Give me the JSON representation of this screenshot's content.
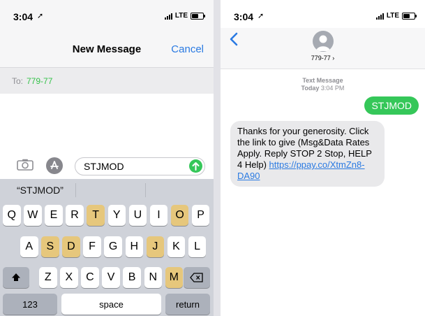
{
  "left": {
    "status": {
      "time": "3:04",
      "network": "LTE"
    },
    "header": {
      "title": "New Message",
      "cancel_label": "Cancel"
    },
    "to": {
      "label": "To:",
      "recipient": "779-77"
    },
    "input": {
      "value": "STJMOD"
    },
    "keyboard": {
      "prediction": "“STJMOD”",
      "row1": [
        "Q",
        "W",
        "E",
        "R",
        "T",
        "Y",
        "U",
        "I",
        "O",
        "P"
      ],
      "row2": [
        "A",
        "S",
        "D",
        "F",
        "G",
        "H",
        "J",
        "K",
        "L"
      ],
      "row3": [
        "Z",
        "X",
        "C",
        "V",
        "B",
        "N",
        "M"
      ],
      "highlighted": [
        "T",
        "O",
        "S",
        "D",
        "J",
        "M"
      ],
      "numbers_label": "123",
      "space_label": "space",
      "return_label": "return"
    }
  },
  "right": {
    "status": {
      "time": "3:04",
      "network": "LTE"
    },
    "header": {
      "contact": "779-77 ›"
    },
    "meta": {
      "type": "Text Message",
      "day": "Today",
      "time": "3:04 PM"
    },
    "messages": {
      "outgoing": "STJMOD",
      "incoming_text": "Thanks for your generosity. Click the link to give (Msg&Data Rates Apply. Reply STOP 2 Stop, HELP 4 Help)",
      "incoming_link": "https://ppay.co/XtmZn8-DA90"
    }
  },
  "colors": {
    "accent": "#2a7ae2",
    "imessage_green": "#35c759",
    "highlight_key": "#e6c77c"
  }
}
